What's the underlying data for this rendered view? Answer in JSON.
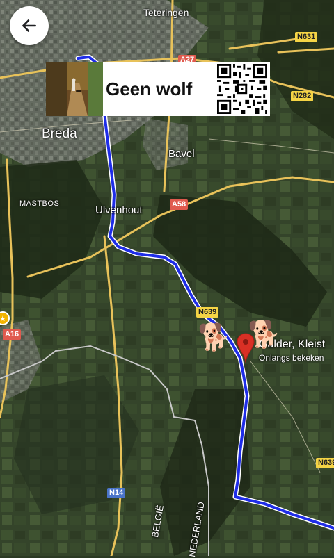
{
  "places": {
    "teteringen": "Teteringen",
    "breda": "Breda",
    "bavel": "Bavel",
    "mastbos": "MASTBOS",
    "ulvenhout": "Ulvenhout",
    "kleist": "Galder, Kleist",
    "kleist_sub": "Onlangs bekeken",
    "belgie": "BELGIË",
    "nederland": "NEDERLAND"
  },
  "roads": {
    "a27": "A27",
    "a58": "A58",
    "a16": "A16",
    "n631": "N631",
    "n282": "N282",
    "n639a": "N639",
    "n639b": "N639",
    "n14": "N14"
  },
  "banner": {
    "title": "Geen wolf"
  },
  "icons": {
    "back": "arrow-left-icon",
    "dog": "🐕",
    "pin": "location-pin-icon",
    "qr": "qr-code-icon"
  },
  "colors": {
    "route": "#1f2de8",
    "pin": "#d93025",
    "road": "#e8c25a",
    "border": "#c8c8c8"
  }
}
